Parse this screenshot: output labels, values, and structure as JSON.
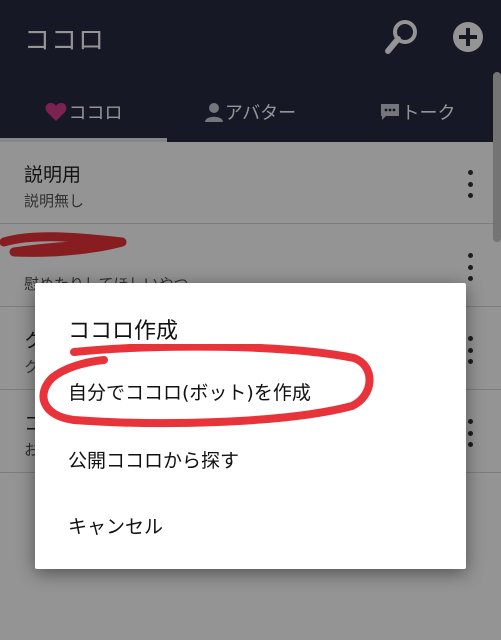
{
  "appbar": {
    "title": "ココロ",
    "search_icon": "search-icon",
    "add_icon": "add-circle-icon"
  },
  "tabs": [
    {
      "label": "ココロ",
      "icon": "heart-icon",
      "icon_color": "#d63b8f",
      "selected": true
    },
    {
      "label": "アバター",
      "icon": "person-icon",
      "selected": false
    },
    {
      "label": "トーク",
      "icon": "chat-bubble-icon",
      "selected": false
    }
  ],
  "list": [
    {
      "title": "説明用",
      "subtitle": "説明無し"
    },
    {
      "title": "",
      "subtitle": "慰めたりしてほしいやつ"
    },
    {
      "title": "ク",
      "subtitle": "ク"
    },
    {
      "title": "コ",
      "subtitle": "お"
    }
  ],
  "dialog": {
    "title": "ココロ作成",
    "items": [
      {
        "label": "自分でココロ(ボット)を作成"
      },
      {
        "label": "公開ココロから探す"
      },
      {
        "label": "キャンセル"
      }
    ]
  },
  "colors": {
    "header_bg": "#262a42",
    "annotation_red": "#e8333a"
  }
}
